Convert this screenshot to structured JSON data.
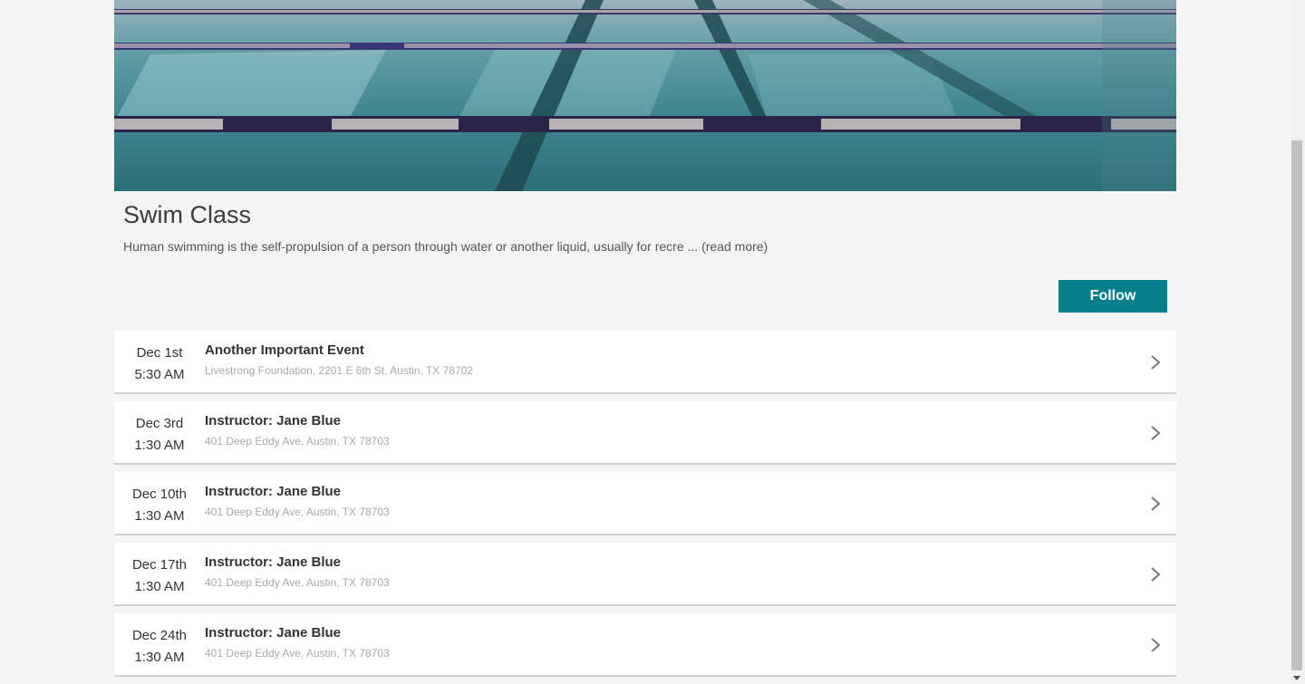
{
  "hero": {
    "alt": "swimming-pool-photo"
  },
  "class": {
    "title": "Swim Class",
    "description": "Human swimming is the self-propulsion of a person through water or another liquid, usually for recre ",
    "read_more": " ... (read more)"
  },
  "actions": {
    "follow_label": "Follow"
  },
  "events": [
    {
      "date": "Dec 1st",
      "time": "5:30 AM",
      "title": "Another Important Event",
      "address": "Livestrong Foundation, 2201 E 6th St, Austin, TX 78702"
    },
    {
      "date": "Dec 3rd",
      "time": "1:30 AM",
      "title": "Instructor: Jane Blue",
      "address": "401 Deep Eddy Ave, Austin, TX 78703"
    },
    {
      "date": "Dec 10th",
      "time": "1:30 AM",
      "title": "Instructor: Jane Blue",
      "address": "401 Deep Eddy Ave, Austin, TX 78703"
    },
    {
      "date": "Dec 17th",
      "time": "1:30 AM",
      "title": "Instructor: Jane Blue",
      "address": "401 Deep Eddy Ave, Austin, TX 78703"
    },
    {
      "date": "Dec 24th",
      "time": "1:30 AM",
      "title": "Instructor: Jane Blue",
      "address": "401 Deep Eddy Ave, Austin, TX 78703"
    }
  ],
  "colors": {
    "accent": "#0a7f8c",
    "background": "#f4f4f4",
    "address_text": "#a8a8a8"
  },
  "icons": {
    "row_chevron": "chevron-right-icon"
  }
}
